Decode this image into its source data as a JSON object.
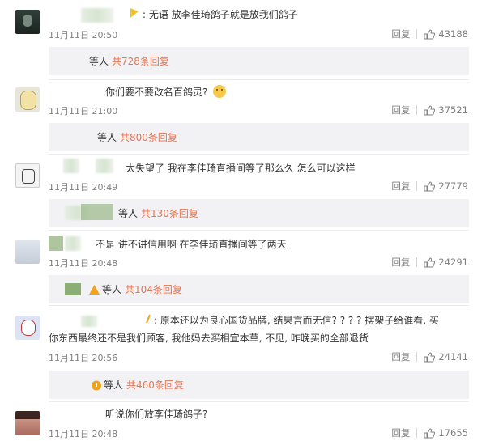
{
  "comments": [
    {
      "text": "无语 放李佳琦鸽子就是放我们鸽子",
      "time": "11月11日 20:50",
      "likes": "43188",
      "replies": {
        "prefix": "等人",
        "link": "共728条回复"
      }
    },
    {
      "text": "你们要不要改名百鸽灵?",
      "time": "11月11日 21:00",
      "likes": "37521",
      "replies": {
        "prefix": "等人",
        "link": "共800条回复"
      }
    },
    {
      "text": "太失望了 我在李佳琦直播间等了那么久 怎么可以这样",
      "time": "11月11日 20:49",
      "likes": "27779",
      "replies": {
        "prefix": "等人",
        "link": "共130条回复"
      }
    },
    {
      "text": "不是 讲不讲信用啊 在李佳琦直播间等了两天",
      "time": "11月11日 20:48",
      "likes": "24291",
      "replies": {
        "prefix": "等人",
        "link": "共104条回复"
      }
    },
    {
      "text_line1": "原本还以为良心国货品牌, 结果言而无信? ? ? ? 摆架子给谁看, 买",
      "text_line2": "你东西最终还不是我们顾客, 我他妈去买相宜本草, 不见, 昨晚买的全部退货",
      "time": "11月11日 20:56",
      "likes": "24141",
      "replies": {
        "prefix": "等人",
        "link": "共460条回复"
      }
    },
    {
      "text": "听说你们放李佳琦鸽子?",
      "time": "11月11日 20:48",
      "likes": "17655"
    }
  ],
  "ui": {
    "reply_label": "回复",
    "colon": ":"
  },
  "colors": {
    "link": "#eb7350",
    "meta": "#808080",
    "reply_bg": "#f2f2f5"
  },
  "icons": [
    "like-icon",
    "warning-icon",
    "emoji-thinking-icon"
  ]
}
